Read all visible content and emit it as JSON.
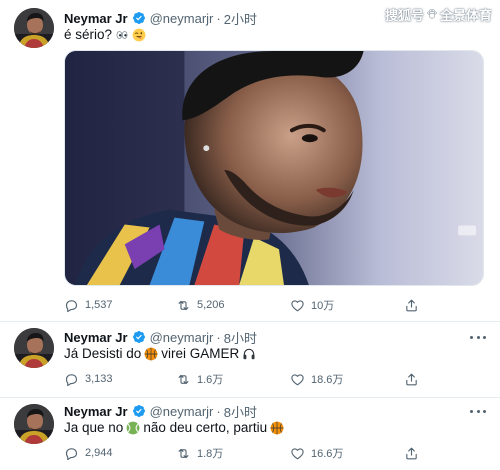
{
  "watermark": {
    "left": "搜狐号",
    "right": "全景体育"
  },
  "tweets": [
    {
      "name": "Neymar Jr",
      "handle": "@neymarjr",
      "separator": "·",
      "time": "2小时",
      "text": {
        "part1": "é sério?",
        "part2": ""
      },
      "emoji": [
        "eyes-emoji",
        "winking-tongue-emoji"
      ],
      "replies": "1,537",
      "retweets": "5,206",
      "likes": "10万"
    },
    {
      "name": "Neymar Jr",
      "handle": "@neymarjr",
      "separator": "·",
      "time": "8小时",
      "text": {
        "part1": "Já Desisti do",
        "part2": "virei GAMER"
      },
      "emoji": [
        "basketball-emoji",
        "headphones-emoji"
      ],
      "replies": "3,133",
      "retweets": "1.6万",
      "likes": "18.6万"
    },
    {
      "name": "Neymar Jr",
      "handle": "@neymarjr",
      "separator": "·",
      "time": "8小时",
      "text": {
        "part1": "Ja que no",
        "part2": "não deu certo, partiu"
      },
      "emoji": [
        "tennis-ball-emoji",
        "basketball-emoji"
      ],
      "replies": "2,944",
      "retweets": "1.8万",
      "likes": "16.6万"
    }
  ],
  "colors": {
    "verified": "#1d9bf0",
    "text_secondary": "#536471",
    "divider": "#e6ecf0"
  }
}
